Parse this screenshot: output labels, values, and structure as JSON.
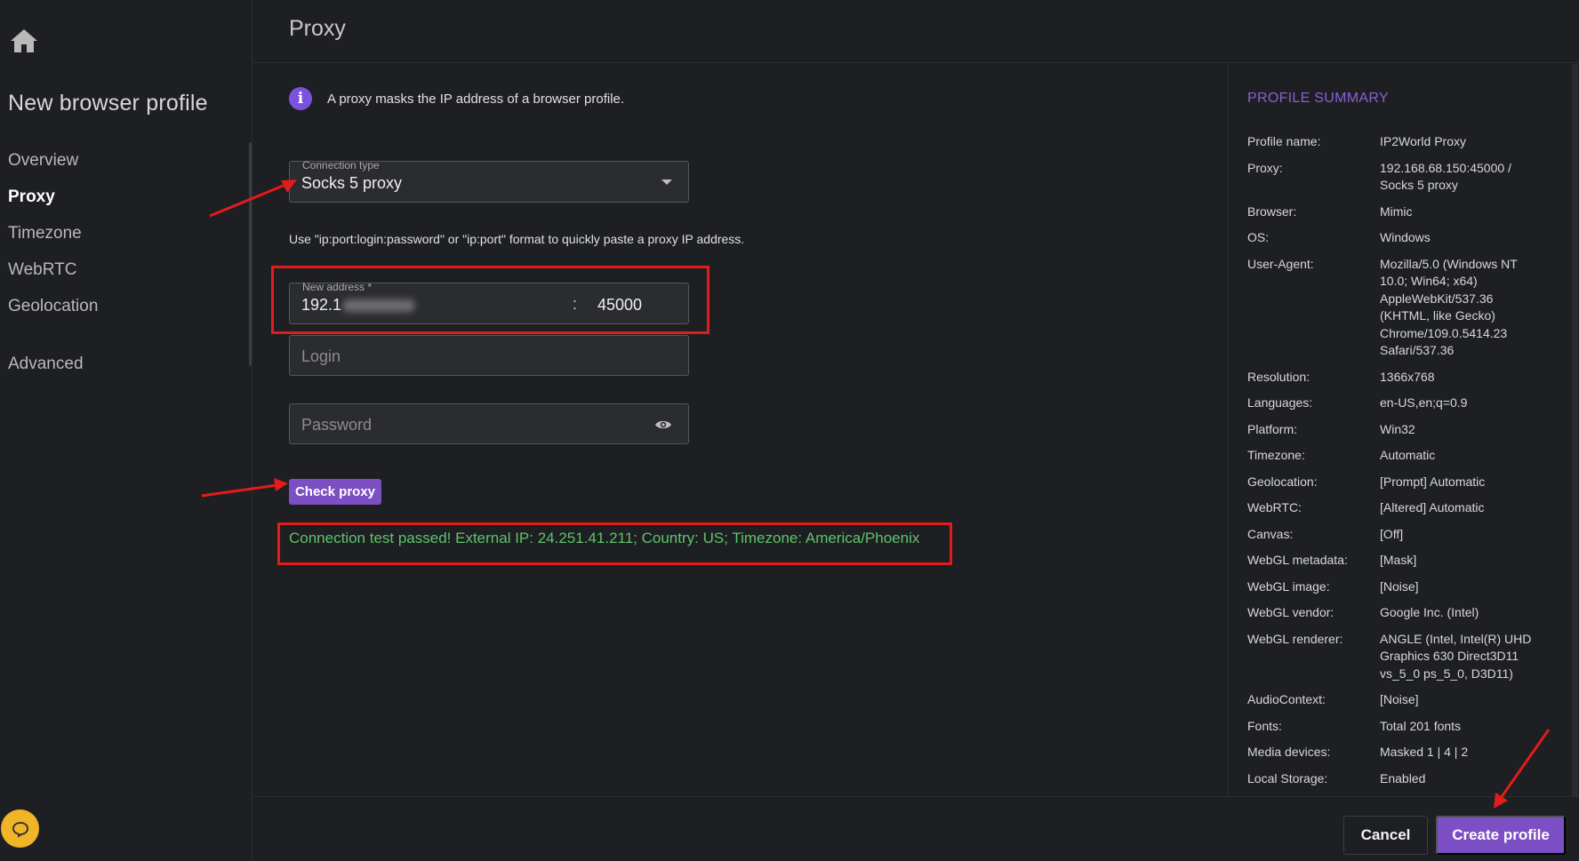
{
  "sidebar": {
    "title": "New browser profile",
    "items": [
      {
        "label": "Overview"
      },
      {
        "label": "Proxy"
      },
      {
        "label": "Timezone"
      },
      {
        "label": "WebRTC"
      },
      {
        "label": "Geolocation"
      },
      {
        "label": "Advanced"
      }
    ]
  },
  "header": {
    "title": "Proxy"
  },
  "main": {
    "info_text": "A proxy masks the IP address of a browser profile.",
    "connection_type": {
      "label": "Connection type",
      "value": "Socks 5 proxy"
    },
    "hint": "Use \"ip:port:login:password\" or \"ip:port\" format to quickly paste a proxy IP address.",
    "address": {
      "label": "New address *",
      "value": "192.1",
      "separator": ":",
      "port": "45000"
    },
    "login": {
      "placeholder": "Login"
    },
    "password": {
      "placeholder": "Password"
    },
    "check_button": "Check proxy",
    "result": "Connection test passed! External IP: 24.251.41.211; Country: US; Timezone: America/Phoenix"
  },
  "summary": {
    "title": "PROFILE SUMMARY",
    "rows": [
      {
        "k": "Profile name:",
        "v": "IP2World Proxy"
      },
      {
        "k": "Proxy:",
        "v": "192.168.68.150:45000 / Socks 5 proxy"
      },
      {
        "k": "Browser:",
        "v": "Mimic"
      },
      {
        "k": "OS:",
        "v": "Windows"
      },
      {
        "k": "User-Agent:",
        "v": "Mozilla/5.0 (Windows NT 10.0; Win64; x64) AppleWebKit/537.36 (KHTML, like Gecko) Chrome/109.0.5414.23 Safari/537.36"
      },
      {
        "k": "Resolution:",
        "v": "1366x768"
      },
      {
        "k": "Languages:",
        "v": "en-US,en;q=0.9"
      },
      {
        "k": "Platform:",
        "v": "Win32"
      },
      {
        "k": "Timezone:",
        "v": "Automatic"
      },
      {
        "k": "Geolocation:",
        "v": "[Prompt] Automatic"
      },
      {
        "k": "WebRTC:",
        "v": "[Altered] Automatic"
      },
      {
        "k": "Canvas:",
        "v": "[Off]"
      },
      {
        "k": "WebGL metadata:",
        "v": "[Mask]"
      },
      {
        "k": "WebGL image:",
        "v": "[Noise]"
      },
      {
        "k": "WebGL vendor:",
        "v": "Google Inc. (Intel)"
      },
      {
        "k": "WebGL renderer:",
        "v": "ANGLE (Intel, Intel(R) UHD Graphics 630 Direct3D11 vs_5_0 ps_5_0, D3D11)"
      },
      {
        "k": "AudioContext:",
        "v": "[Noise]"
      },
      {
        "k": "Fonts:",
        "v": "Total 201 fonts"
      },
      {
        "k": "Media devices:",
        "v": "Masked 1 | 4 | 2"
      },
      {
        "k": "Local Storage:",
        "v": "Enabled"
      }
    ]
  },
  "footer": {
    "cancel": "Cancel",
    "create": "Create profile"
  },
  "colors": {
    "accent": "#7d4fc5",
    "success": "#5dc46a",
    "annotation": "#e11c1c"
  }
}
